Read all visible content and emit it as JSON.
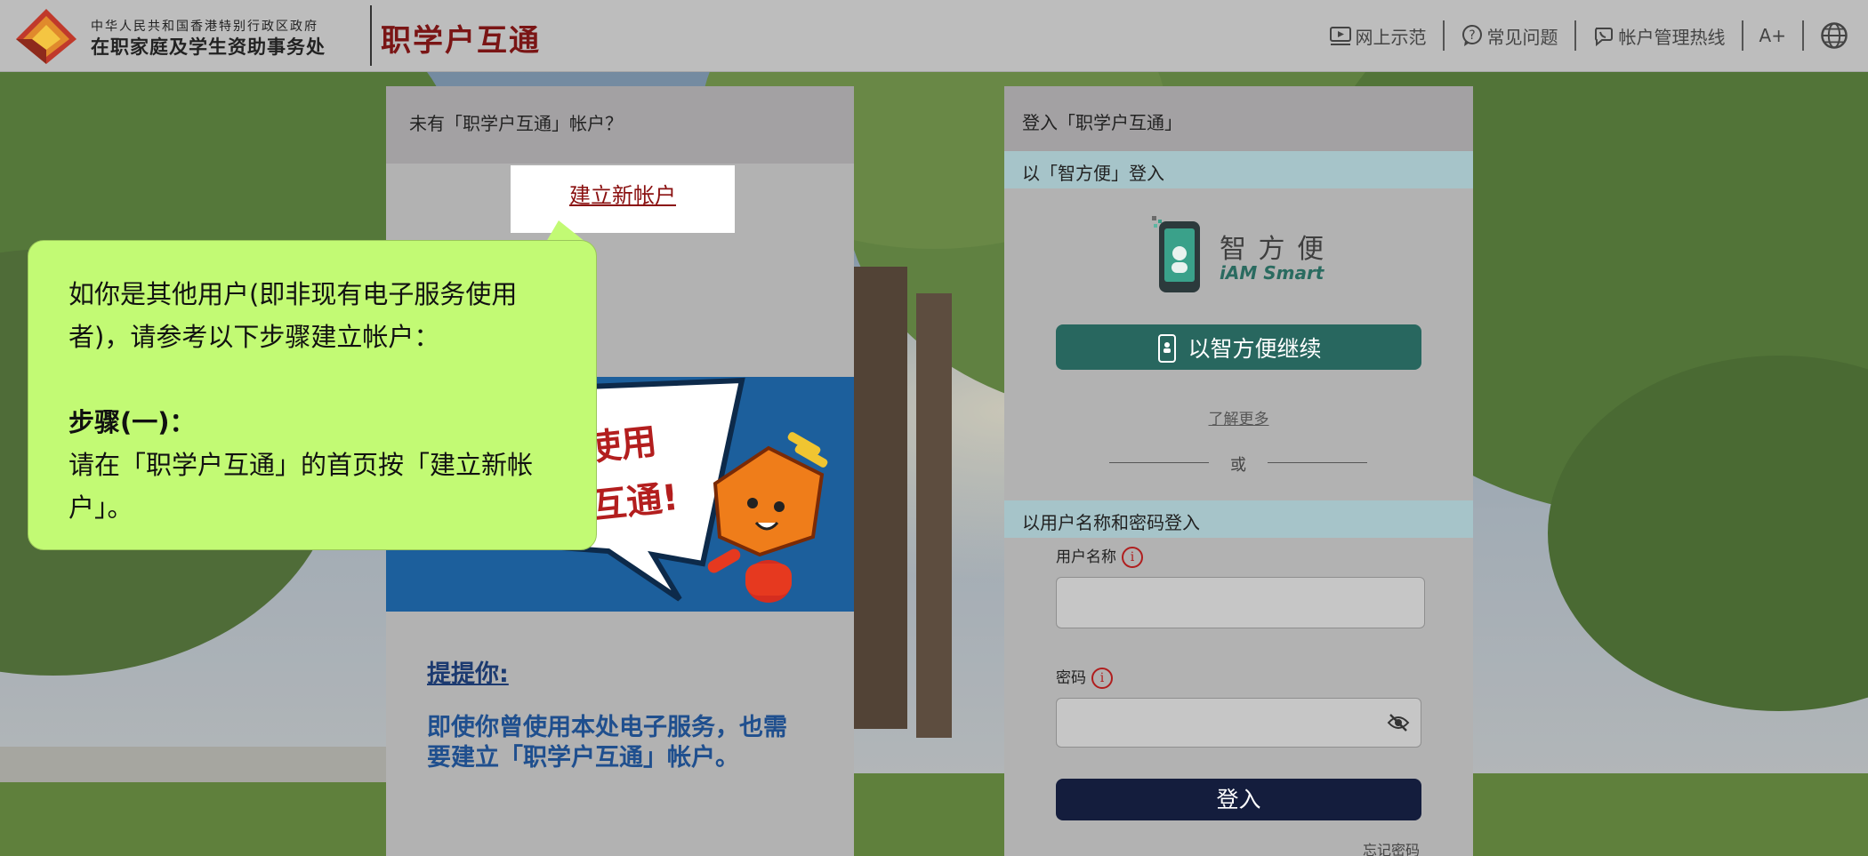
{
  "header": {
    "dept_line1": "中华人民共和国香港特别行政区政府",
    "dept_line2": "在职家庭及学生资助事务处",
    "brand": "职学户互通",
    "nav": {
      "demo": "网上示范",
      "faq": "常见问题",
      "hotline": "帐户管理热线",
      "font_size": "A+"
    }
  },
  "left_panel": {
    "title": "未有「职学户互通」帐户？",
    "create_account": "建立新帐户",
    "promo_line1": "使用",
    "promo_line2": "互通!",
    "reminder_title": "提提你:",
    "reminder_body": "即使你曾使用本处电子服务，也需要建立「职学户互通」帐户。"
  },
  "tooltip": {
    "intro": "如你是其他用户(即非现有电子服务使用者)，请参考以下步骤建立帐户：",
    "step_title": "步骤(一)：",
    "step_body": "请在「职学户互通」的首页按「建立新帐户」。"
  },
  "login_panel": {
    "title": "登入「职学户互通」",
    "iam_section": "以「智方便」登入",
    "iam_logo_cn": "智 方 便",
    "iam_logo_en": "iAM Smart",
    "iam_button": "以智方便继续",
    "learn_more": "了解更多",
    "or": "或",
    "password_section": "以用户名称和密码登入",
    "username_label": "用户名称",
    "password_label": "密码",
    "username_value": "",
    "password_value": "",
    "login_button": "登入",
    "forgot_password": "忘记密码"
  },
  "colors": {
    "brand": "#7a1515",
    "tooltip_bg": "#c2fa74",
    "iam_button": "#28675f",
    "login_button": "#141d3d",
    "section_bar": "#a6c4c9"
  },
  "icons": [
    "emblem-logo",
    "video-demo-icon",
    "faq-icon",
    "hotline-icon",
    "globe-icon",
    "phone-icon",
    "info-icon",
    "eye-slash-icon"
  ]
}
